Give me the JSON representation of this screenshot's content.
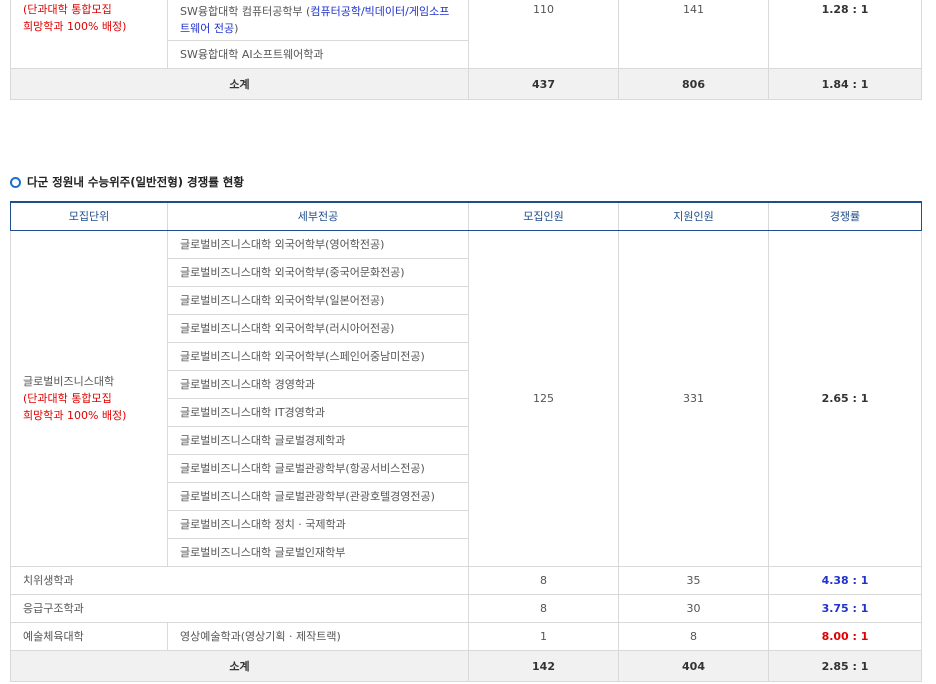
{
  "table1": {
    "unit_line1": "(단과대학 통합모집",
    "unit_line2": "희망학과 100% 배정)",
    "row1_major_prefix": "SW융합대학 컴퓨터공학부 (",
    "row1_major_blue": "컴퓨터공학/빅데이터/게임소프트웨어 전공",
    "row1_major_suffix": ")",
    "row2_major": "SW융합대학 AI소프트웨어학과",
    "quota": "110",
    "applicants": "141",
    "rate": "1.28 : 1",
    "subtotal_label": "소계",
    "subtotal_quota": "437",
    "subtotal_applicants": "806",
    "subtotal_rate": "1.84 : 1"
  },
  "section_title": "다군 정원내 수능위주(일반전형) 경쟁률 현황",
  "table2": {
    "headers": [
      "모집단위",
      "세부전공",
      "모집인원",
      "지원인원",
      "경쟁률"
    ],
    "global": {
      "unit_line1": "글로벌비즈니스대학",
      "unit_line2": "(단과대학 통합모집",
      "unit_line3": "희망학과 100% 배정)",
      "majors": [
        "글로벌비즈니스대학 외국어학부(영어학전공)",
        "글로벌비즈니스대학 외국어학부(중국어문화전공)",
        "글로벌비즈니스대학 외국어학부(일본어전공)",
        "글로벌비즈니스대학 외국어학부(러시아어전공)",
        "글로벌비즈니스대학 외국어학부(스페인어중남미전공)",
        "글로벌비즈니스대학 경영학과",
        "글로벌비즈니스대학 IT경영학과",
        "글로벌비즈니스대학 글로벌경제학과",
        "글로벌비즈니스대학 글로벌관광학부(항공서비스전공)",
        "글로벌비즈니스대학 글로벌관광학부(관광호텔경영전공)",
        "글로벌비즈니스대학 정치 · 국제학과",
        "글로벌비즈니스대학 글로벌인재학부"
      ],
      "quota": "125",
      "applicants": "331",
      "rate": "2.65 : 1"
    },
    "rows": [
      {
        "unit": "치위생학과",
        "major": "",
        "quota": "8",
        "applicants": "35",
        "rate": "4.38 : 1"
      },
      {
        "unit": "응급구조학과",
        "major": "",
        "quota": "8",
        "applicants": "30",
        "rate": "3.75 : 1"
      },
      {
        "unit": "예술체육대학",
        "major": "영상예술학과(영상기획 · 제작트랙)",
        "quota": "1",
        "applicants": "8",
        "rate": "8.00 : 1"
      }
    ],
    "subtotal_label": "소계",
    "subtotal_quota": "142",
    "subtotal_applicants": "404",
    "subtotal_rate": "2.85 : 1"
  },
  "colors": {
    "accent_red": "#e00000",
    "accent_blue": "#2233cc",
    "header_navy": "#1f4e8c"
  }
}
